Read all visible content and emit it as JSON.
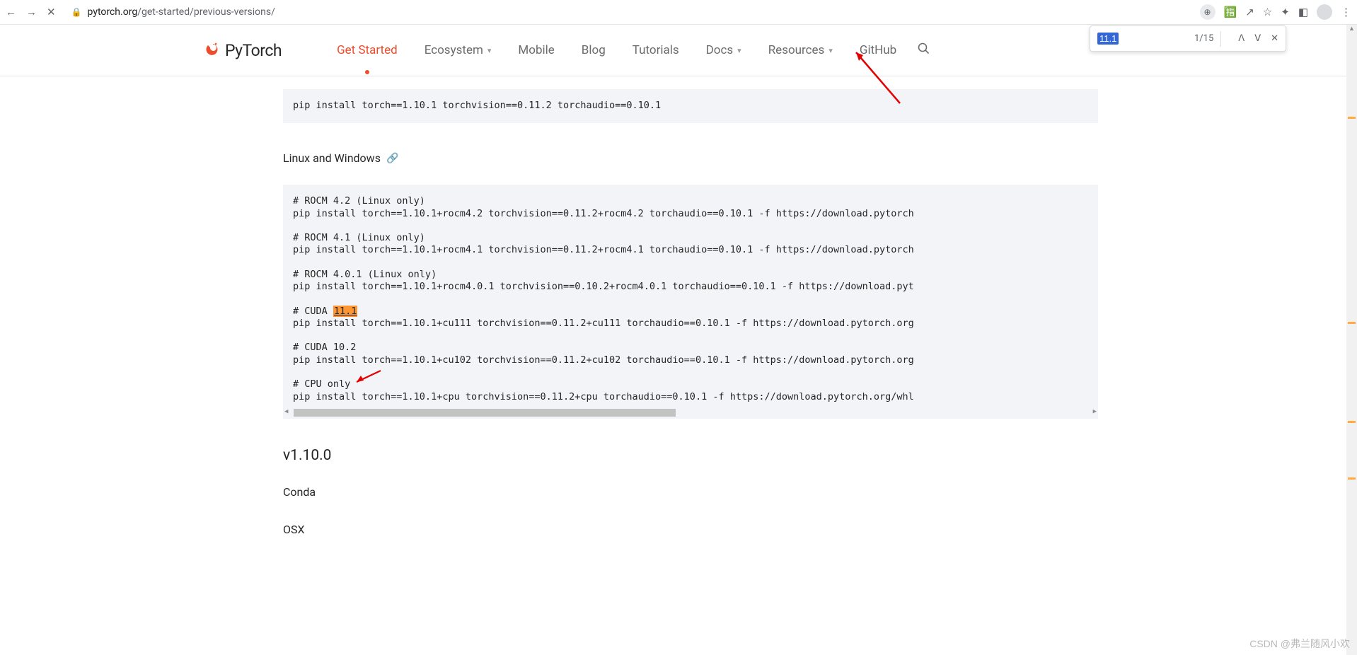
{
  "browser": {
    "url_host": "pytorch.org",
    "url_path": "/get-started/previous-versions/",
    "find": {
      "query": "11.1",
      "count": "1/15"
    }
  },
  "nav": {
    "brand": "PyTorch",
    "items": {
      "get_started": "Get Started",
      "ecosystem": "Ecosystem",
      "mobile": "Mobile",
      "blog": "Blog",
      "tutorials": "Tutorials",
      "docs": "Docs",
      "resources": "Resources",
      "github": "GitHub"
    }
  },
  "code1": "pip install torch==1.10.1 torchvision==0.11.2 torchaudio==0.10.1",
  "heading_lw": "Linux and Windows",
  "code2": {
    "l1": "# ROCM 4.2 (Linux only)",
    "l2": "pip install torch==1.10.1+rocm4.2 torchvision==0.11.2+rocm4.2 torchaudio==0.10.1 -f https://download.pytorch",
    "l4": "# ROCM 4.1 (Linux only)",
    "l5": "pip install torch==1.10.1+rocm4.1 torchvision==0.11.2+rocm4.1 torchaudio==0.10.1 -f https://download.pytorch",
    "l7": "# ROCM 4.0.1 (Linux only)",
    "l8": "pip install torch==1.10.1+rocm4.0.1 torchvision==0.10.2+rocm4.0.1 torchaudio==0.10.1 -f https://download.pyt",
    "l10a": "# CUDA ",
    "l10b": "11.1",
    "l11": "pip install torch==1.10.1+cu111 torchvision==0.11.2+cu111 torchaudio==0.10.1 -f https://download.pytorch.org",
    "l13": "# CUDA 10.2",
    "l14": "pip install torch==1.10.1+cu102 torchvision==0.11.2+cu102 torchaudio==0.10.1 -f https://download.pytorch.org",
    "l16": "# CPU only",
    "l17": "pip install torch==1.10.1+cpu torchvision==0.11.2+cpu torchaudio==0.10.1 -f https://download.pytorch.org/whl"
  },
  "heading_v": "v1.10.0",
  "heading_conda": "Conda",
  "heading_osx": "OSX",
  "watermark": "CSDN @弗兰随风小欢"
}
